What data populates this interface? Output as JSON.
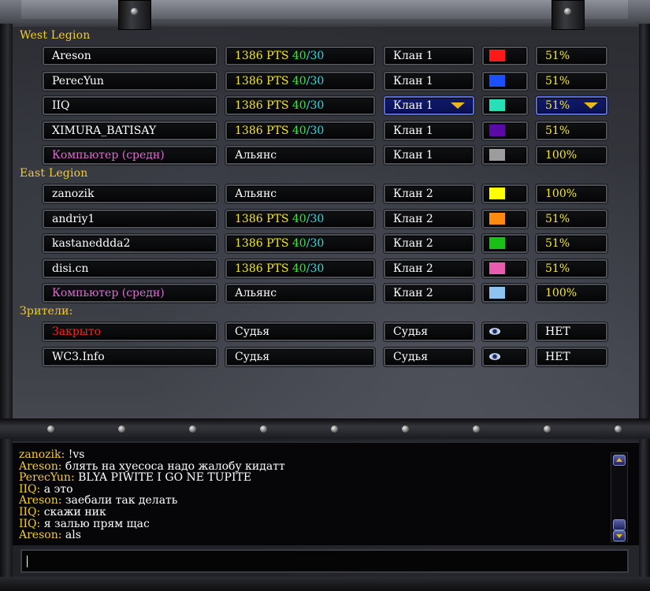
{
  "west_legion": {
    "heading": "West Legion",
    "rows": [
      {
        "name": "Areson",
        "name_class": "",
        "pts": "1386 PTS",
        "w": "40",
        "l": "30",
        "slot": "",
        "clan": "Клан 1",
        "color": "#ff1a1a",
        "hc": "51%",
        "selected": false
      },
      {
        "name": "PerecYun",
        "name_class": "",
        "pts": "1386 PTS",
        "w": "40",
        "l": "30",
        "slot": "",
        "clan": "Клан 1",
        "color": "#1a50ff",
        "hc": "51%",
        "selected": false
      },
      {
        "name": "IIQ",
        "name_class": "",
        "pts": "1386 PTS",
        "w": "40",
        "l": "30",
        "slot": "",
        "clan": "Клан 1",
        "color": "#28e0b8",
        "hc": "51%",
        "selected": true
      },
      {
        "name": "XIMURA_BATISAY",
        "name_class": "",
        "pts": "1386 PTS",
        "w": "40",
        "l": "30",
        "slot": "",
        "clan": "Клан 1",
        "color": "#5a0aa6",
        "hc": "51%",
        "selected": false
      },
      {
        "name": "Компьютер (средн)",
        "name_class": "pink",
        "pts": "",
        "w": "",
        "l": "",
        "slot": "Альянс",
        "clan": "Клан 1",
        "color": "#9c9c9c",
        "hc": "100%",
        "selected": false
      }
    ]
  },
  "east_legion": {
    "heading": "East Legion",
    "rows": [
      {
        "name": "zanozik",
        "name_class": "",
        "pts": "",
        "w": "",
        "l": "",
        "slot": "Альянс",
        "clan": "Клан 2",
        "color": "#ffff00",
        "hc": "100%",
        "selected": false
      },
      {
        "name": "andriy1",
        "name_class": "",
        "pts": "1386 PTS",
        "w": "40",
        "l": "30",
        "slot": "",
        "clan": "Клан 2",
        "color": "#ff8a10",
        "hc": "51%",
        "selected": false
      },
      {
        "name": "kastaneddda2",
        "name_class": "",
        "pts": "1386 PTS",
        "w": "40",
        "l": "30",
        "slot": "",
        "clan": "Клан 2",
        "color": "#18c018",
        "hc": "51%",
        "selected": false
      },
      {
        "name": "disi.cn",
        "name_class": "",
        "pts": "1386 PTS",
        "w": "40",
        "l": "30",
        "slot": "",
        "clan": "Клан 2",
        "color": "#e85cb0",
        "hc": "51%",
        "selected": false
      },
      {
        "name": "Компьютер (средн)",
        "name_class": "pink",
        "pts": "",
        "w": "",
        "l": "",
        "slot": "Альянс",
        "clan": "Клан 2",
        "color": "#8ec2f0",
        "hc": "100%",
        "selected": false
      }
    ]
  },
  "observers": {
    "heading": "Зрители:",
    "rows": [
      {
        "name": "Закрыто",
        "name_class": "red",
        "slot": "Судья",
        "clan": "Судья",
        "icon": "eye-icon",
        "hc": "НЕТ"
      },
      {
        "name": "WC3.Info",
        "name_class": "",
        "slot": "Судья",
        "clan": "Судья",
        "icon": "eye-icon",
        "hc": "НЕТ"
      }
    ]
  },
  "chat": {
    "messages": [
      {
        "from": "zanozik",
        "text": "!vs"
      },
      {
        "from": "Areson",
        "text": "блять на хуесоса надо жалобу кидатт"
      },
      {
        "from": "PerecYun",
        "text": "BLYA PIWITE I GO NE TUPITE"
      },
      {
        "from": "IIQ",
        "text": "а это"
      },
      {
        "from": "Areson",
        "text": "заебали так делать"
      },
      {
        "from": "IIQ",
        "text": "скажи ник"
      },
      {
        "from": "IIQ",
        "text": "я залью прям щас"
      },
      {
        "from": "Areson",
        "text": "als"
      }
    ],
    "input_value": ""
  },
  "colors": {
    "gold": "#f2cc2e",
    "wins": "#3fe03f",
    "losses": "#3ad6d6",
    "computer": "#e06ad2",
    "closed": "#ff2020"
  }
}
